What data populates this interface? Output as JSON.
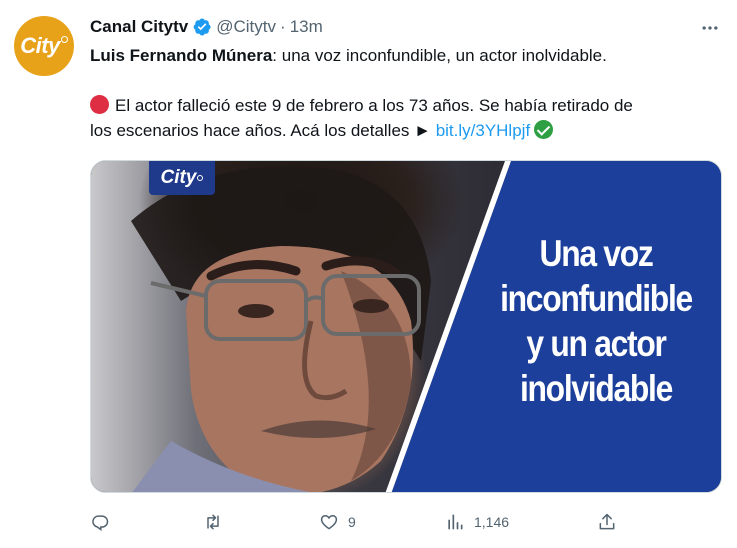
{
  "author": {
    "avatar_text": "City",
    "name": "Canal Citytv",
    "handle": "@Citytv",
    "separator": "·",
    "time": "13m",
    "verified_icon": "verified-badge-icon"
  },
  "tweet": {
    "title_bold": "Luis Fernando Múnera",
    "title_rest": ": una voz inconfundible, un actor inolvidable.",
    "body_line1": "El actor falleció este 9 de febrero a los 73 años. Se había retirado de",
    "body_line2_text": "los escenarios hace años. Acá los detalles ► ",
    "link_text": "bit.ly/3YHlpjf",
    "emoji_start": "red-circle-icon",
    "emoji_end": "check-mark-button-icon"
  },
  "media": {
    "badge_text": "City",
    "headline_lines": [
      "Una voz",
      "inconfundible",
      "y un actor",
      "inolvidable"
    ],
    "panel_color": "#1c3f9c"
  },
  "actions": {
    "reply": {
      "icon": "reply-icon",
      "count": ""
    },
    "retweet": {
      "icon": "retweet-icon",
      "count": ""
    },
    "like": {
      "icon": "heart-icon",
      "count": "9"
    },
    "views": {
      "icon": "views-icon",
      "count": "1,146"
    },
    "share": {
      "icon": "share-icon",
      "count": ""
    }
  },
  "colors": {
    "accent": "#1d9bf0",
    "secondary_text": "#536471",
    "brand_orange": "#e8a21a",
    "verified_blue": "#1d9bf0"
  }
}
